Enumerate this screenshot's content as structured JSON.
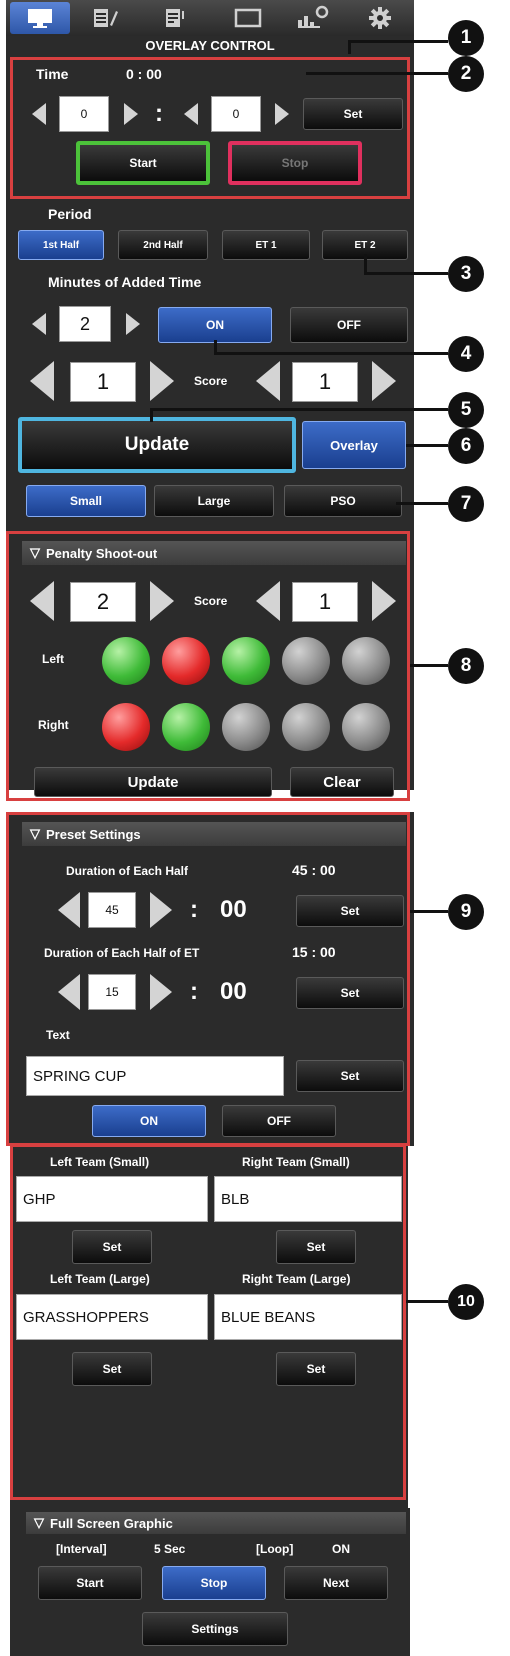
{
  "overlay": {
    "title": "OVERLAY CONTROL",
    "tabs": [
      "display-icon",
      "edit-icon",
      "list-edit-icon",
      "window-icon",
      "chart-gear-icon",
      "gear-icon"
    ],
    "time_label": "Time",
    "time_value": "0 : 00",
    "minutes_box": "0",
    "seconds_box": "0",
    "colon": ":",
    "set_label": "Set",
    "start_label": "Start",
    "stop_label": "Stop",
    "period_label": "Period",
    "periods": [
      "1st Half",
      "2nd Half",
      "ET 1",
      "ET 2"
    ],
    "added_time_label": "Minutes of Added Time",
    "added_time_value": "2",
    "on_label": "ON",
    "off_label": "OFF",
    "score_label": "Score",
    "score_left": "1",
    "score_right": "1",
    "update_label": "Update",
    "overlay_label": "Overlay",
    "sizes": [
      "Small",
      "Large",
      "PSO"
    ]
  },
  "penalty": {
    "header": "Penalty Shoot-out",
    "score_label": "Score",
    "score_left": "2",
    "score_right": "1",
    "left_label": "Left",
    "right_label": "Right",
    "left_results": [
      "green",
      "red",
      "green",
      "gray",
      "gray"
    ],
    "right_results": [
      "red",
      "green",
      "gray",
      "gray",
      "gray"
    ],
    "update_label": "Update",
    "clear_label": "Clear"
  },
  "preset": {
    "header": "Preset Settings",
    "half_label": "Duration of Each Half",
    "half_value": "45 : 00",
    "half_box": "45",
    "half_seconds": "00",
    "et_label": "Duration of Each Half of ET",
    "et_value": "15 : 00",
    "et_box": "15",
    "et_seconds": "00",
    "colon": ":",
    "text_label": "Text",
    "text_value": "SPRING CUP",
    "set_label": "Set",
    "on_label": "ON",
    "off_label": "OFF"
  },
  "teams": {
    "left_small_label": "Left Team (Small)",
    "right_small_label": "Right Team (Small)",
    "left_small_value": "GHP",
    "right_small_value": "BLB",
    "left_large_label": "Left Team (Large)",
    "right_large_label": "Right Team (Large)",
    "left_large_value": "GRASSHOPPERS",
    "right_large_value": "BLUE BEANS",
    "set_label": "Set"
  },
  "fullscreen": {
    "header": "Full Screen Graphic",
    "interval_label": "[Interval]",
    "interval_value": "5 Sec",
    "loop_label": "[Loop]",
    "loop_value": "ON",
    "start_label": "Start",
    "stop_label": "Stop",
    "next_label": "Next",
    "settings_label": "Settings"
  },
  "callouts": [
    "1",
    "2",
    "3",
    "4",
    "5",
    "6",
    "7",
    "8",
    "9",
    "10"
  ],
  "colors": {
    "panel": "#2b2b2b",
    "accent_blue": "#2f5fbf",
    "frame_red": "#d84040",
    "start_green": "#4cc23a",
    "stop_pink": "#e0305e",
    "update_cyan": "#4fb6e0"
  }
}
